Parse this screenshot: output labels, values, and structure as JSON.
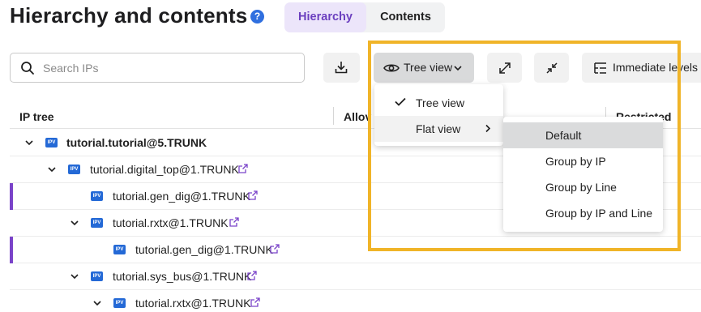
{
  "page": {
    "title": "Hierarchy and contents",
    "help_icon": "question-circle-icon",
    "help_glyph": "?"
  },
  "tabs": [
    {
      "label": "Hierarchy",
      "active": true
    },
    {
      "label": "Contents",
      "active": false
    }
  ],
  "search": {
    "placeholder": "Search IPs",
    "value": ""
  },
  "toolbar": {
    "download_icon": "download-icon",
    "view_label": "Tree view",
    "view_icon": "eye-icon",
    "expand_icon": "expand-arrows-icon",
    "collapse_icon": "collapse-arrows-icon",
    "levels_label": "Immediate levels",
    "levels_icon": "hierarchy-levels-icon"
  },
  "table": {
    "columns": [
      "IP tree",
      "Allov",
      "Restricted geos"
    ],
    "rows": [
      {
        "name": "tutorial.tutorial@5.TRUNK",
        "badge": "IPV",
        "bold": true,
        "expanded": true,
        "link": false,
        "marked": false
      },
      {
        "name": "tutorial.digital_top@1.TRUNK",
        "badge": "IPV",
        "bold": false,
        "expanded": true,
        "link": true,
        "marked": false
      },
      {
        "name": "tutorial.gen_dig@1.TRUNK",
        "badge": "IPV",
        "bold": false,
        "expanded": null,
        "link": true,
        "marked": true
      },
      {
        "name": "tutorial.rxtx@1.TRUNK",
        "badge": "IPV",
        "bold": false,
        "expanded": true,
        "link": true,
        "marked": false
      },
      {
        "name": "tutorial.gen_dig@1.TRUNK",
        "badge": "IPV",
        "bold": false,
        "expanded": null,
        "link": true,
        "marked": true
      },
      {
        "name": "tutorial.sys_bus@1.TRUNK",
        "badge": "IPV",
        "bold": false,
        "expanded": true,
        "link": true,
        "marked": false
      },
      {
        "name": "tutorial.rxtx@1.TRUNK",
        "badge": "IPV",
        "bold": false,
        "expanded": true,
        "link": true,
        "marked": false
      }
    ]
  },
  "view_menu": {
    "items": [
      {
        "label": "Tree view",
        "checked": true,
        "has_submenu": false
      },
      {
        "label": "Flat view",
        "checked": false,
        "has_submenu": true
      }
    ]
  },
  "flat_submenu": {
    "items": [
      {
        "label": "Default",
        "selected": true
      },
      {
        "label": "Group by IP",
        "selected": false
      },
      {
        "label": "Group by Line",
        "selected": false
      },
      {
        "label": "Group by IP and Line",
        "selected": false
      }
    ]
  },
  "colors": {
    "accent_purple": "#6b3fbf",
    "tab_active_bg": "#ece5fa",
    "badge_blue": "#2469d6",
    "highlight_border": "#f0b428",
    "row_marker": "#7a43c9"
  }
}
